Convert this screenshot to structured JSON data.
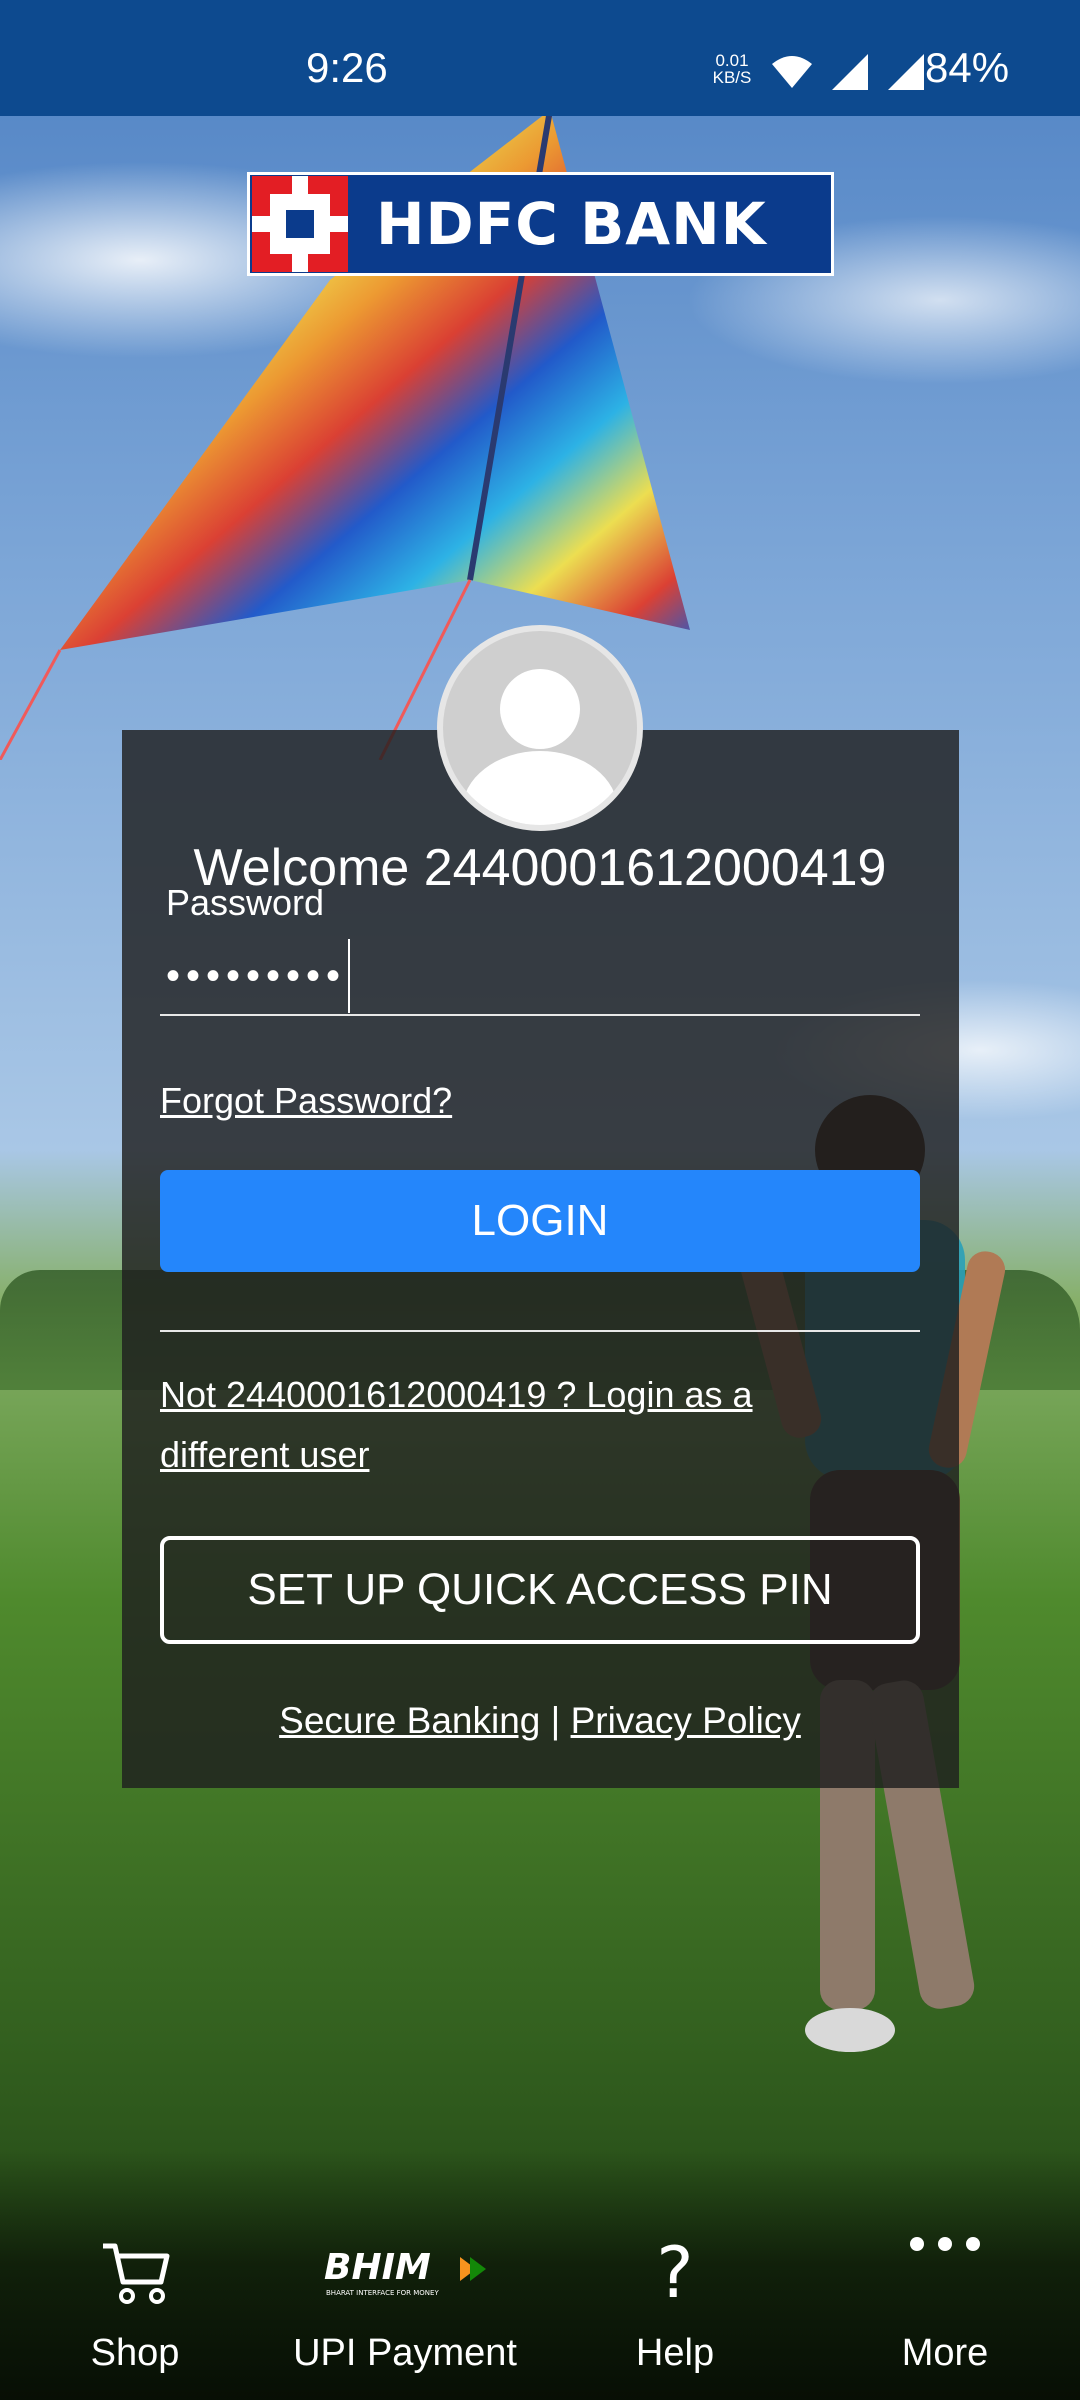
{
  "status_bar": {
    "time": "9:26",
    "net_speed_value": "0.01",
    "net_speed_unit": "KB/S",
    "battery": "84%",
    "icons": [
      "wifi-icon",
      "signal-icon",
      "signal-icon"
    ]
  },
  "brand": {
    "name": "HDFC BANK",
    "colors": {
      "navy": "#0b3b8c",
      "red": "#e31e24",
      "status_bar": "#0d4a8f"
    }
  },
  "login": {
    "welcome": "Welcome 2440001612000419",
    "password_label": "Password",
    "password_value": "•••••••••",
    "forgot_password": "Forgot Password?",
    "login_button": "LOGIN",
    "login_button_color": "#2486fb",
    "not_user": "Not 2440001612000419 ? Login as a different user",
    "quick_pin_button": "SET UP QUICK ACCESS PIN",
    "secure_banking": "Secure Banking",
    "separator": "|",
    "privacy_policy": "Privacy Policy"
  },
  "bottom_nav": {
    "items": [
      {
        "label": "Shop",
        "icon": "cart-icon"
      },
      {
        "label": "UPI Payment",
        "icon": "bhim-logo-icon",
        "icon_text": "BHIM",
        "icon_subtext": "BHARAT INTERFACE FOR MONEY"
      },
      {
        "label": "Help",
        "icon": "question-icon",
        "icon_text": "?"
      },
      {
        "label": "More",
        "icon": "more-dots-icon"
      }
    ]
  }
}
